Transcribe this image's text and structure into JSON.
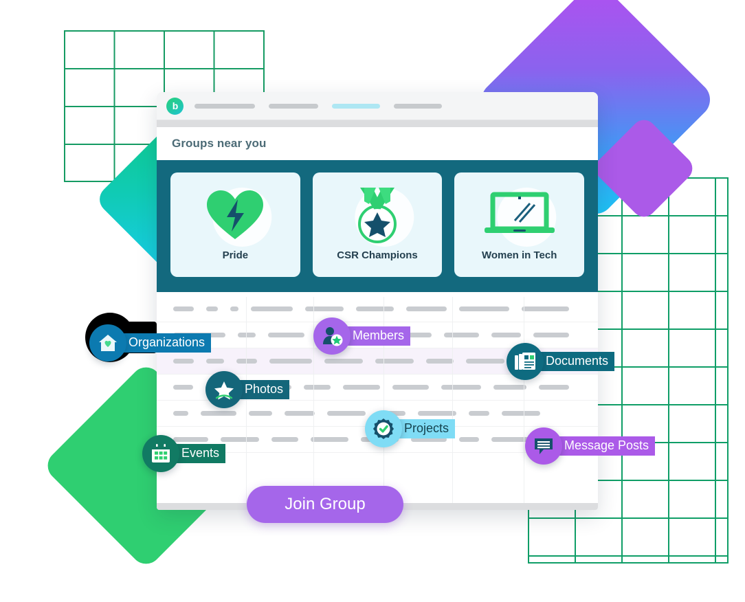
{
  "app": {
    "logo_glyph": "b",
    "nav_placeholder_count": 4,
    "page_title": "Groups near you"
  },
  "cards": [
    {
      "label": "Pride",
      "icon": "heart-bolt-icon"
    },
    {
      "label": "CSR Champions",
      "icon": "medal-star-icon"
    },
    {
      "label": "Women in Tech",
      "icon": "laptop-icon"
    }
  ],
  "badges": [
    {
      "label": "Organizations",
      "icon": "home-heart-icon",
      "circle_color": "#0c7ab0",
      "pill_color": "#0c7ab0",
      "text_color": "#ffffff"
    },
    {
      "label": "Members",
      "icon": "person-star-icon",
      "circle_color": "#a566ea",
      "pill_color": "#a566ea",
      "text_color": "#ffffff"
    },
    {
      "label": "Documents",
      "icon": "newspaper-icon",
      "circle_color": "#0e6b80",
      "pill_color": "#0e6b80",
      "text_color": "#ffffff"
    },
    {
      "label": "Photos",
      "icon": "star-photo-icon",
      "circle_color": "#14667a",
      "pill_color": "#14667a",
      "text_color": "#ffffff"
    },
    {
      "label": "Projects",
      "icon": "check-badge-icon",
      "circle_color": "#7fdcf5",
      "pill_color": "#7fdcf5",
      "text_color": "#15434f"
    },
    {
      "label": "Events",
      "icon": "calendar-icon",
      "circle_color": "#117a63",
      "pill_color": "#117a63",
      "text_color": "#ffffff"
    },
    {
      "label": "Message Posts",
      "icon": "chat-lines-icon",
      "circle_color": "#ab5ae8",
      "pill_color": "#ab5ae8",
      "text_color": "#ffffff"
    }
  ],
  "cta": {
    "label": "Join Group"
  },
  "colors": {
    "band": "#13697e",
    "card_bg": "#e9f7fb",
    "accent_green": "#2fcf71",
    "accent_purple": "#a566ea",
    "grid_green": "#0f9e67",
    "title_text": "#4c6b76",
    "row_highlight": "#f7f2fb"
  },
  "table_rows": [
    {
      "highlight": false,
      "cells": [
        30,
        18,
        12,
        62,
        56,
        56,
        60,
        74,
        70
      ]
    },
    {
      "highlight": false,
      "cells": [
        88,
        30,
        62,
        56,
        40,
        56,
        60,
        50,
        60
      ]
    },
    {
      "highlight": true,
      "cells": [
        30,
        26,
        30,
        62,
        56,
        56,
        40,
        56,
        60
      ]
    },
    {
      "highlight": false,
      "cells": [
        30,
        56,
        56,
        40,
        56,
        56,
        60,
        50,
        46
      ]
    },
    {
      "highlight": false,
      "cells": [
        22,
        52,
        34,
        44,
        56,
        40,
        56,
        30,
        56
      ]
    },
    {
      "highlight": false,
      "cells": [
        52,
        56,
        40,
        56,
        56,
        52,
        30,
        56,
        40
      ]
    }
  ]
}
